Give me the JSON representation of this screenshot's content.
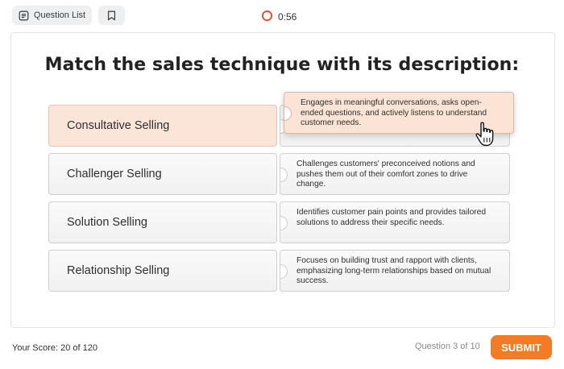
{
  "header": {
    "question_list_label": "Question List",
    "question_list_icon": "list-icon",
    "bookmark_icon": "bookmark-icon",
    "timer_label": "0:56",
    "timer_icon": "timer-ring-icon",
    "timer_color": "#e8442c"
  },
  "question": {
    "title": "Match the sales technique with its description:"
  },
  "matching": {
    "terms": [
      {
        "label": "Consultative Selling",
        "selected": true
      },
      {
        "label": "Challenger Selling",
        "selected": false
      },
      {
        "label": "Solution Selling",
        "selected": false
      },
      {
        "label": "Relationship Selling",
        "selected": false
      }
    ],
    "descriptions": [
      {
        "text": "Engages in meaningful conversations, asks open-ended questions, and actively listens to understand customer needs.",
        "dragging": true
      },
      {
        "text": "Challenges customers' preconceived notions and pushes them out of their comfort zones to drive change.",
        "dragging": false
      },
      {
        "text": "Identifies customer pain points and provides tailored solutions to address their specific needs.",
        "dragging": false
      },
      {
        "text": "Focuses on building trust and rapport with clients, emphasizing long-term relationships based on mutual success.",
        "dragging": false
      }
    ],
    "selected_color": "#fbe5d9"
  },
  "footer": {
    "score_label": "Your Score: 20 of 120",
    "progress_label": "Question 3 of 10",
    "submit_label": "SUBMIT",
    "accent_color": "#f47b25"
  }
}
